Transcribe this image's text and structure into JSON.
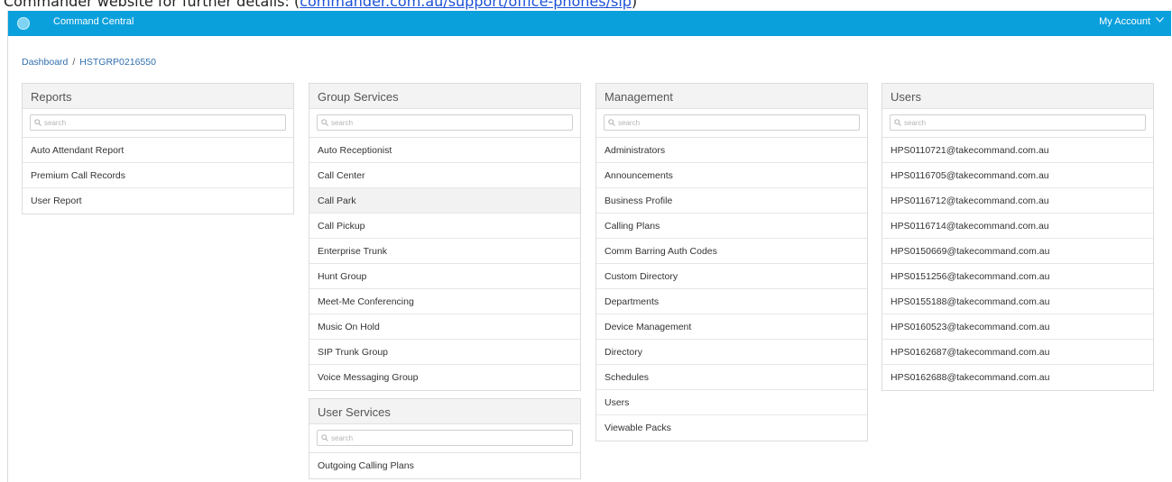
{
  "doc": {
    "text_before": "Commander website for further details: (",
    "link": "commander.com.au/support/office-phones/sip",
    "text_after": ")"
  },
  "nav": {
    "brand": "Command Central",
    "account": "My Account"
  },
  "breadcrumb": {
    "root": "Dashboard",
    "separator": "/",
    "current": "HSTGRP0216550"
  },
  "search_placeholder": "search",
  "reports": {
    "title": "Reports",
    "items": [
      "Auto Attendant Report",
      "Premium Call Records",
      "User Report"
    ]
  },
  "group_services": {
    "title": "Group Services",
    "items": [
      "Auto Receptionist",
      "Call Center",
      "Call Park",
      "Call Pickup",
      "Enterprise Trunk",
      "Hunt Group",
      "Meet-Me Conferencing",
      "Music On Hold",
      "SIP Trunk Group",
      "Voice Messaging Group"
    ],
    "highlighted_index": 2
  },
  "user_services": {
    "title": "User Services",
    "items": [
      "Outgoing Calling Plans"
    ]
  },
  "management": {
    "title": "Management",
    "items": [
      "Administrators",
      "Announcements",
      "Business Profile",
      "Calling Plans",
      "Comm Barring Auth Codes",
      "Custom Directory",
      "Departments",
      "Device Management",
      "Directory",
      "Schedules",
      "Users",
      "Viewable Packs"
    ]
  },
  "users": {
    "title": "Users",
    "items": [
      "HPS0110721@takecommand.com.au",
      "HPS0116705@takecommand.com.au",
      "HPS0116712@takecommand.com.au",
      "HPS0116714@takecommand.com.au",
      "HPS0150669@takecommand.com.au",
      "HPS0151256@takecommand.com.au",
      "HPS0155188@takecommand.com.au",
      "HPS0160523@takecommand.com.au",
      "HPS0162687@takecommand.com.au",
      "HPS0162688@takecommand.com.au"
    ]
  },
  "colors": {
    "navbar": "#0aa0dc",
    "link": "#2f6fae",
    "panel_header": "#f3f3f3"
  },
  "icons": {
    "logo": "brand-logo-icon",
    "account_caret": "chevron-down-icon",
    "search": "search-icon"
  }
}
